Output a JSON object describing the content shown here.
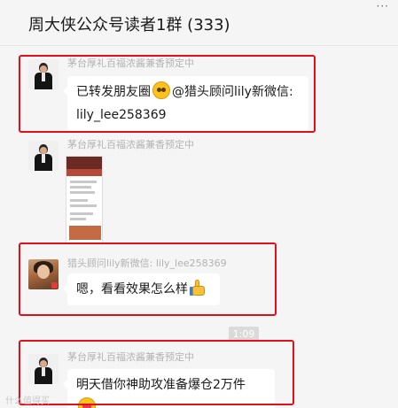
{
  "header": {
    "title": "周大侠公众号读者1群 (333)",
    "more_icon": "more-dots-icon"
  },
  "messages": [
    {
      "sender": "茅台厚礼百福浓酱兼香预定中",
      "avatar": "avatar-suit-man",
      "text_line1_before": "已转发朋友圈",
      "text_line1_emoji": "grin-emoji",
      "text_line1_after": "@猎头顾问lily新微信:",
      "text_line2": "lily_lee258369"
    },
    {
      "sender": "茅台厚礼百福浓酱兼香预定中",
      "avatar": "avatar-suit-man",
      "image": "moments-screenshot-thumbnail"
    },
    {
      "sender": "猎头顾问lily新微信: lily_lee258369",
      "avatar": "avatar-photo-woman",
      "text_before": "嗯，看看效果怎么样",
      "text_emoji": "thumbs-up-emoji"
    },
    {
      "sender": "茅台厚礼百福浓酱兼香预定中",
      "avatar": "avatar-suit-man",
      "text_before": "明天借你神助攻准备爆仓2万件",
      "text_emoji": "heart-eyes-emoji"
    }
  ],
  "timestamp": "1:09",
  "highlight_color": "#e0101a",
  "watermark": "什么值得买"
}
